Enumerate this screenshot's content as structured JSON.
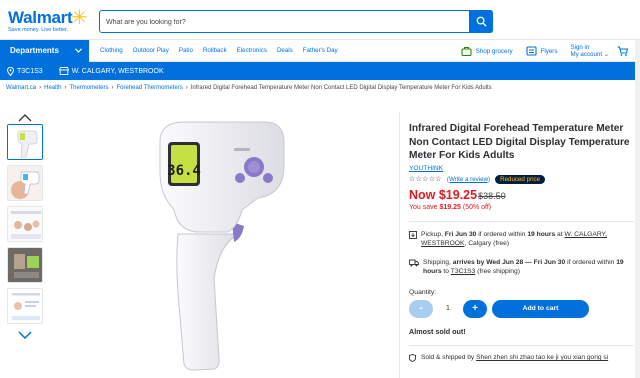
{
  "header": {
    "logo_word": "Walmart",
    "logo_tagline": "Save money. Live better.",
    "search_placeholder": "What are you looking for?"
  },
  "nav": {
    "departments_label": "Departments",
    "links": [
      "Clothing",
      "Outdoor Play",
      "Patio",
      "Rollback",
      "Electronics",
      "Deals",
      "Father's Day"
    ],
    "shop_grocery": "Shop grocery",
    "flyers": "Flyers",
    "sign_in": "Sign in",
    "my_account": "My account"
  },
  "location": {
    "postal": "T3C1S3",
    "store": "W. CALGARY, WESTBROOK"
  },
  "breadcrumb": {
    "items": [
      "Walmart.ca",
      "Health",
      "Thermometers",
      "Forehead Thermometers"
    ],
    "current": "Infrared Digital Forehead Temperature Meter Non Contact LED Digital Display Temperature Meter For Kids Adults"
  },
  "product": {
    "title": "Infrared Digital Forehead Temperature Meter Non Contact LED Digital Display Temperature Meter For Kids Adults",
    "brand": "YOUTHINK",
    "stars": "☆☆☆☆☆",
    "review_link": "(Write a review)",
    "badge": "Reduced price",
    "now_price": "Now $19.25",
    "was_price": "$38.50",
    "save_prefix": "You save ",
    "save_amount": "$19.25",
    "save_pct": " (50% off)",
    "display_reading": "36.4"
  },
  "fulfillment": {
    "pickup_label": "Pickup, ",
    "pickup_date": "Fri Jun 30",
    "pickup_mid": " if ordered within ",
    "pickup_hours": "19 hours",
    "pickup_at": " at ",
    "pickup_store": "W. CALGARY, WESTBROOK",
    "pickup_city": ", Calgary",
    "pickup_free": " (free)",
    "ship_label": "Shipping, ",
    "ship_dates": "arrives by Wed Jun 28 — Fri Jun 30",
    "ship_mid": " if ordered within ",
    "ship_hours": "19 hours",
    "ship_to": " to ",
    "ship_postal": "T3C1S3",
    "ship_free": " (free shipping)"
  },
  "purchase": {
    "quantity_label": "Quantity:",
    "minus": "-",
    "quantity": "1",
    "plus": "+",
    "add_to_cart": "Add to cart",
    "sold_out": "Almost sold out!"
  },
  "seller": {
    "label": "Sold & shipped by",
    "name": "Shen zhen shi zhao tao ke ji you xian gong si"
  },
  "colors": {
    "brand_blue": "#0071dc",
    "price_red": "#de1c24",
    "spark_yellow": "#ffc220",
    "device_purple": "#8a78c9"
  }
}
